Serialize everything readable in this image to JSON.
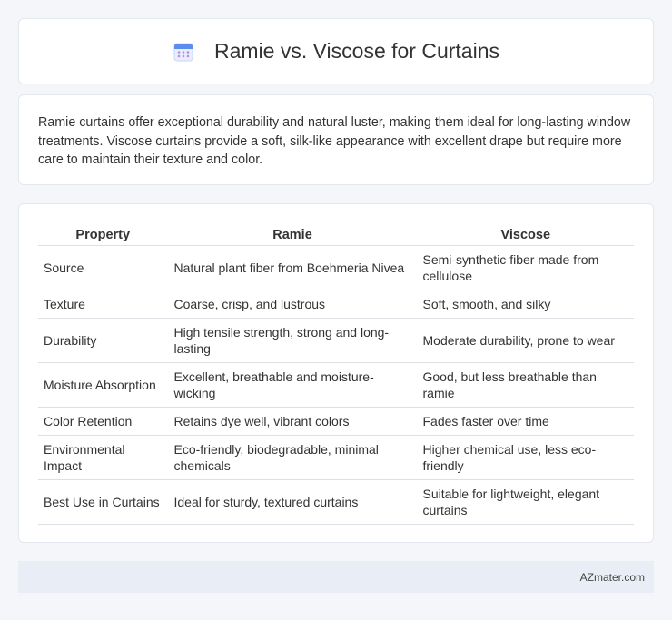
{
  "header": {
    "title": "Ramie vs. Viscose for Curtains",
    "icon": "calendar-icon",
    "icon_colors": {
      "top": "#5b8def",
      "body": "#e9eefc",
      "dots": "#b58ae8"
    }
  },
  "intro": {
    "text": "Ramie curtains offer exceptional durability and natural luster, making them ideal for long-lasting window treatments. Viscose curtains provide a soft, silk-like appearance with excellent drape but require more care to maintain their texture and color."
  },
  "table": {
    "headers": [
      "Property",
      "Ramie",
      "Viscose"
    ],
    "rows": [
      [
        "Source",
        "Natural plant fiber from Boehmeria Nivea",
        "Semi-synthetic fiber made from cellulose"
      ],
      [
        "Texture",
        "Coarse, crisp, and lustrous",
        "Soft, smooth, and silky"
      ],
      [
        "Durability",
        "High tensile strength, strong and long-lasting",
        "Moderate durability, prone to wear"
      ],
      [
        "Moisture Absorption",
        "Excellent, breathable and moisture-wicking",
        "Good, but less breathable than ramie"
      ],
      [
        "Color Retention",
        "Retains dye well, vibrant colors",
        "Fades faster over time"
      ],
      [
        "Environmental Impact",
        "Eco-friendly, biodegradable, minimal chemicals",
        "Higher chemical use, less eco-friendly"
      ],
      [
        "Best Use in Curtains",
        "Ideal for sturdy, textured curtains",
        "Suitable for lightweight, elegant curtains"
      ]
    ]
  },
  "footer": {
    "brand": "AZmater.com"
  }
}
